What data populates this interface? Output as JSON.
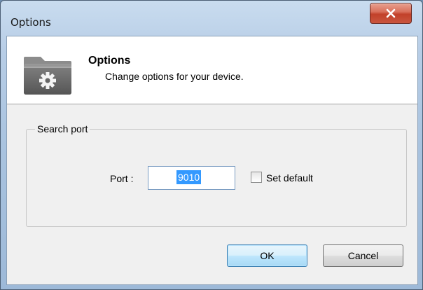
{
  "window": {
    "title": "Options",
    "close_icon": "close-x-icon"
  },
  "header": {
    "icon": "settings-folder-icon",
    "title": "Options",
    "subtitle": "Change options for your device."
  },
  "search_port": {
    "group_label": "Search port",
    "port_label": "Port :",
    "port_value": "9010",
    "set_default_label": "Set default",
    "set_default_checked": false
  },
  "buttons": {
    "ok_label": "OK",
    "cancel_label": "Cancel"
  },
  "colors": {
    "titlebar": "#b7cde6",
    "close_button": "#c9563f",
    "ok_highlight": "#3c7fb1",
    "selection": "#3399ff"
  }
}
